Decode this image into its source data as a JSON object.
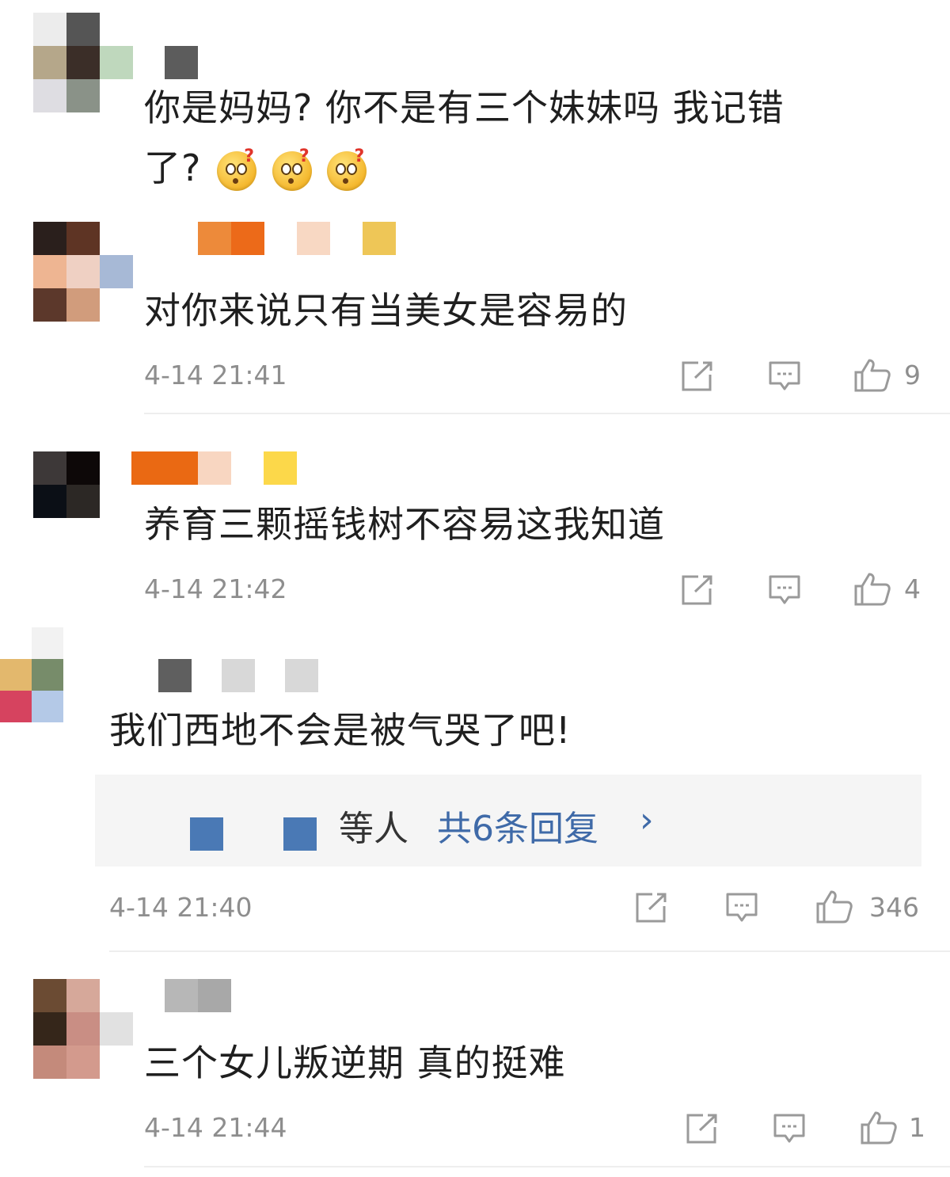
{
  "comments": [
    {
      "text_line1": "你是妈妈? 你不是有三个妹妹吗 我记错",
      "text_line2": "了?",
      "emoji_icons": [
        "thinking-face-icon",
        "thinking-face-icon",
        "thinking-face-icon"
      ]
    },
    {
      "text": "对你来说只有当美女是容易的",
      "time": "4-14 21:41",
      "likes": "9"
    },
    {
      "text": "养育三颗摇钱树不容易这我知道",
      "time": "4-14 21:42",
      "likes": "4"
    },
    {
      "text": "我们西地不会是被气哭了吧!",
      "reply_suffix": "等人",
      "reply_link": "共6条回复",
      "reply_arrow": "›",
      "time": "4-14 21:40",
      "likes": "346"
    },
    {
      "text": "三个女儿叛逆期 真的挺难",
      "time": "4-14 21:44",
      "likes": "1"
    }
  ],
  "icons": {
    "share": "share-icon",
    "comment": "comment-icon",
    "like": "thumbs-up-icon"
  },
  "colors": {
    "text": "#1f1f1f",
    "meta": "#8e8e8e",
    "link": "#3f6aa8",
    "reply_bg": "#f5f5f5",
    "divider": "#eeeeee"
  }
}
